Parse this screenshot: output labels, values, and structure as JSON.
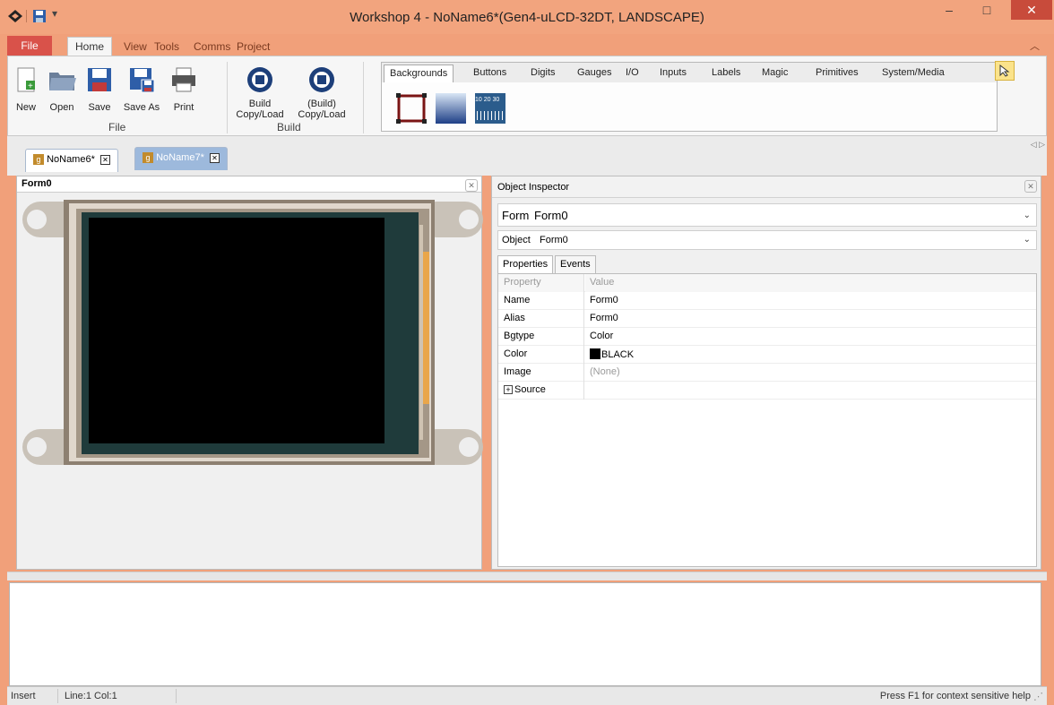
{
  "window": {
    "title": "Workshop 4 - NoName6*(Gen4-uLCD-32DT, LANDSCAPE)",
    "min_glyph": "‒",
    "max_glyph": "□",
    "close_glyph": "✕",
    "collapse_glyph": "︿"
  },
  "ribbon": {
    "tabs": [
      "File",
      "Home",
      "View",
      "Tools",
      "Comms",
      "Project"
    ],
    "file_group": {
      "label": "File",
      "buttons": [
        "New",
        "Open",
        "Save",
        "Save As",
        "Print"
      ]
    },
    "build_group": {
      "label": "Build",
      "build_line1": "Build",
      "build_line2": "Copy/Load",
      "build2_line1": "(Build)",
      "build2_line2": "Copy/Load"
    }
  },
  "palette": {
    "tabs": [
      "Backgrounds",
      "Buttons",
      "Digits",
      "Gauges",
      "I/O",
      "Inputs",
      "Labels",
      "Magic",
      "Primitives",
      "System/Media"
    ],
    "ruler_text": "10 20 30"
  },
  "doc_tabs": {
    "tab1": "NoName6*",
    "tab2": "NoName7*",
    "close_glyph": "✕",
    "nav_glyph": "◁ ▷"
  },
  "form_panel": {
    "title": "Form0"
  },
  "inspector": {
    "title": "Object Inspector",
    "form_label": "Form",
    "form_value": "Form0",
    "object_label": "Object",
    "object_value": "Form0",
    "tabs": [
      "Properties",
      "Events"
    ],
    "header": {
      "property": "Property",
      "value": "Value"
    },
    "rows": [
      {
        "property": "Name",
        "value": "Form0"
      },
      {
        "property": "Alias",
        "value": "Form0"
      },
      {
        "property": "Bgtype",
        "value": "Color"
      },
      {
        "property": "Color",
        "value": "BLACK"
      },
      {
        "property": "Image",
        "value": "(None)"
      },
      {
        "property": "Source",
        "value": ""
      }
    ]
  },
  "statusbar": {
    "mode": "Insert",
    "position": "Line:1 Col:1",
    "help": "Press F1 for context sensitive help"
  },
  "colors": {
    "title_bar": "#f2a47e",
    "file_tab": "#d9524a",
    "close_button": "#c84b3b",
    "screen": "#000000"
  }
}
